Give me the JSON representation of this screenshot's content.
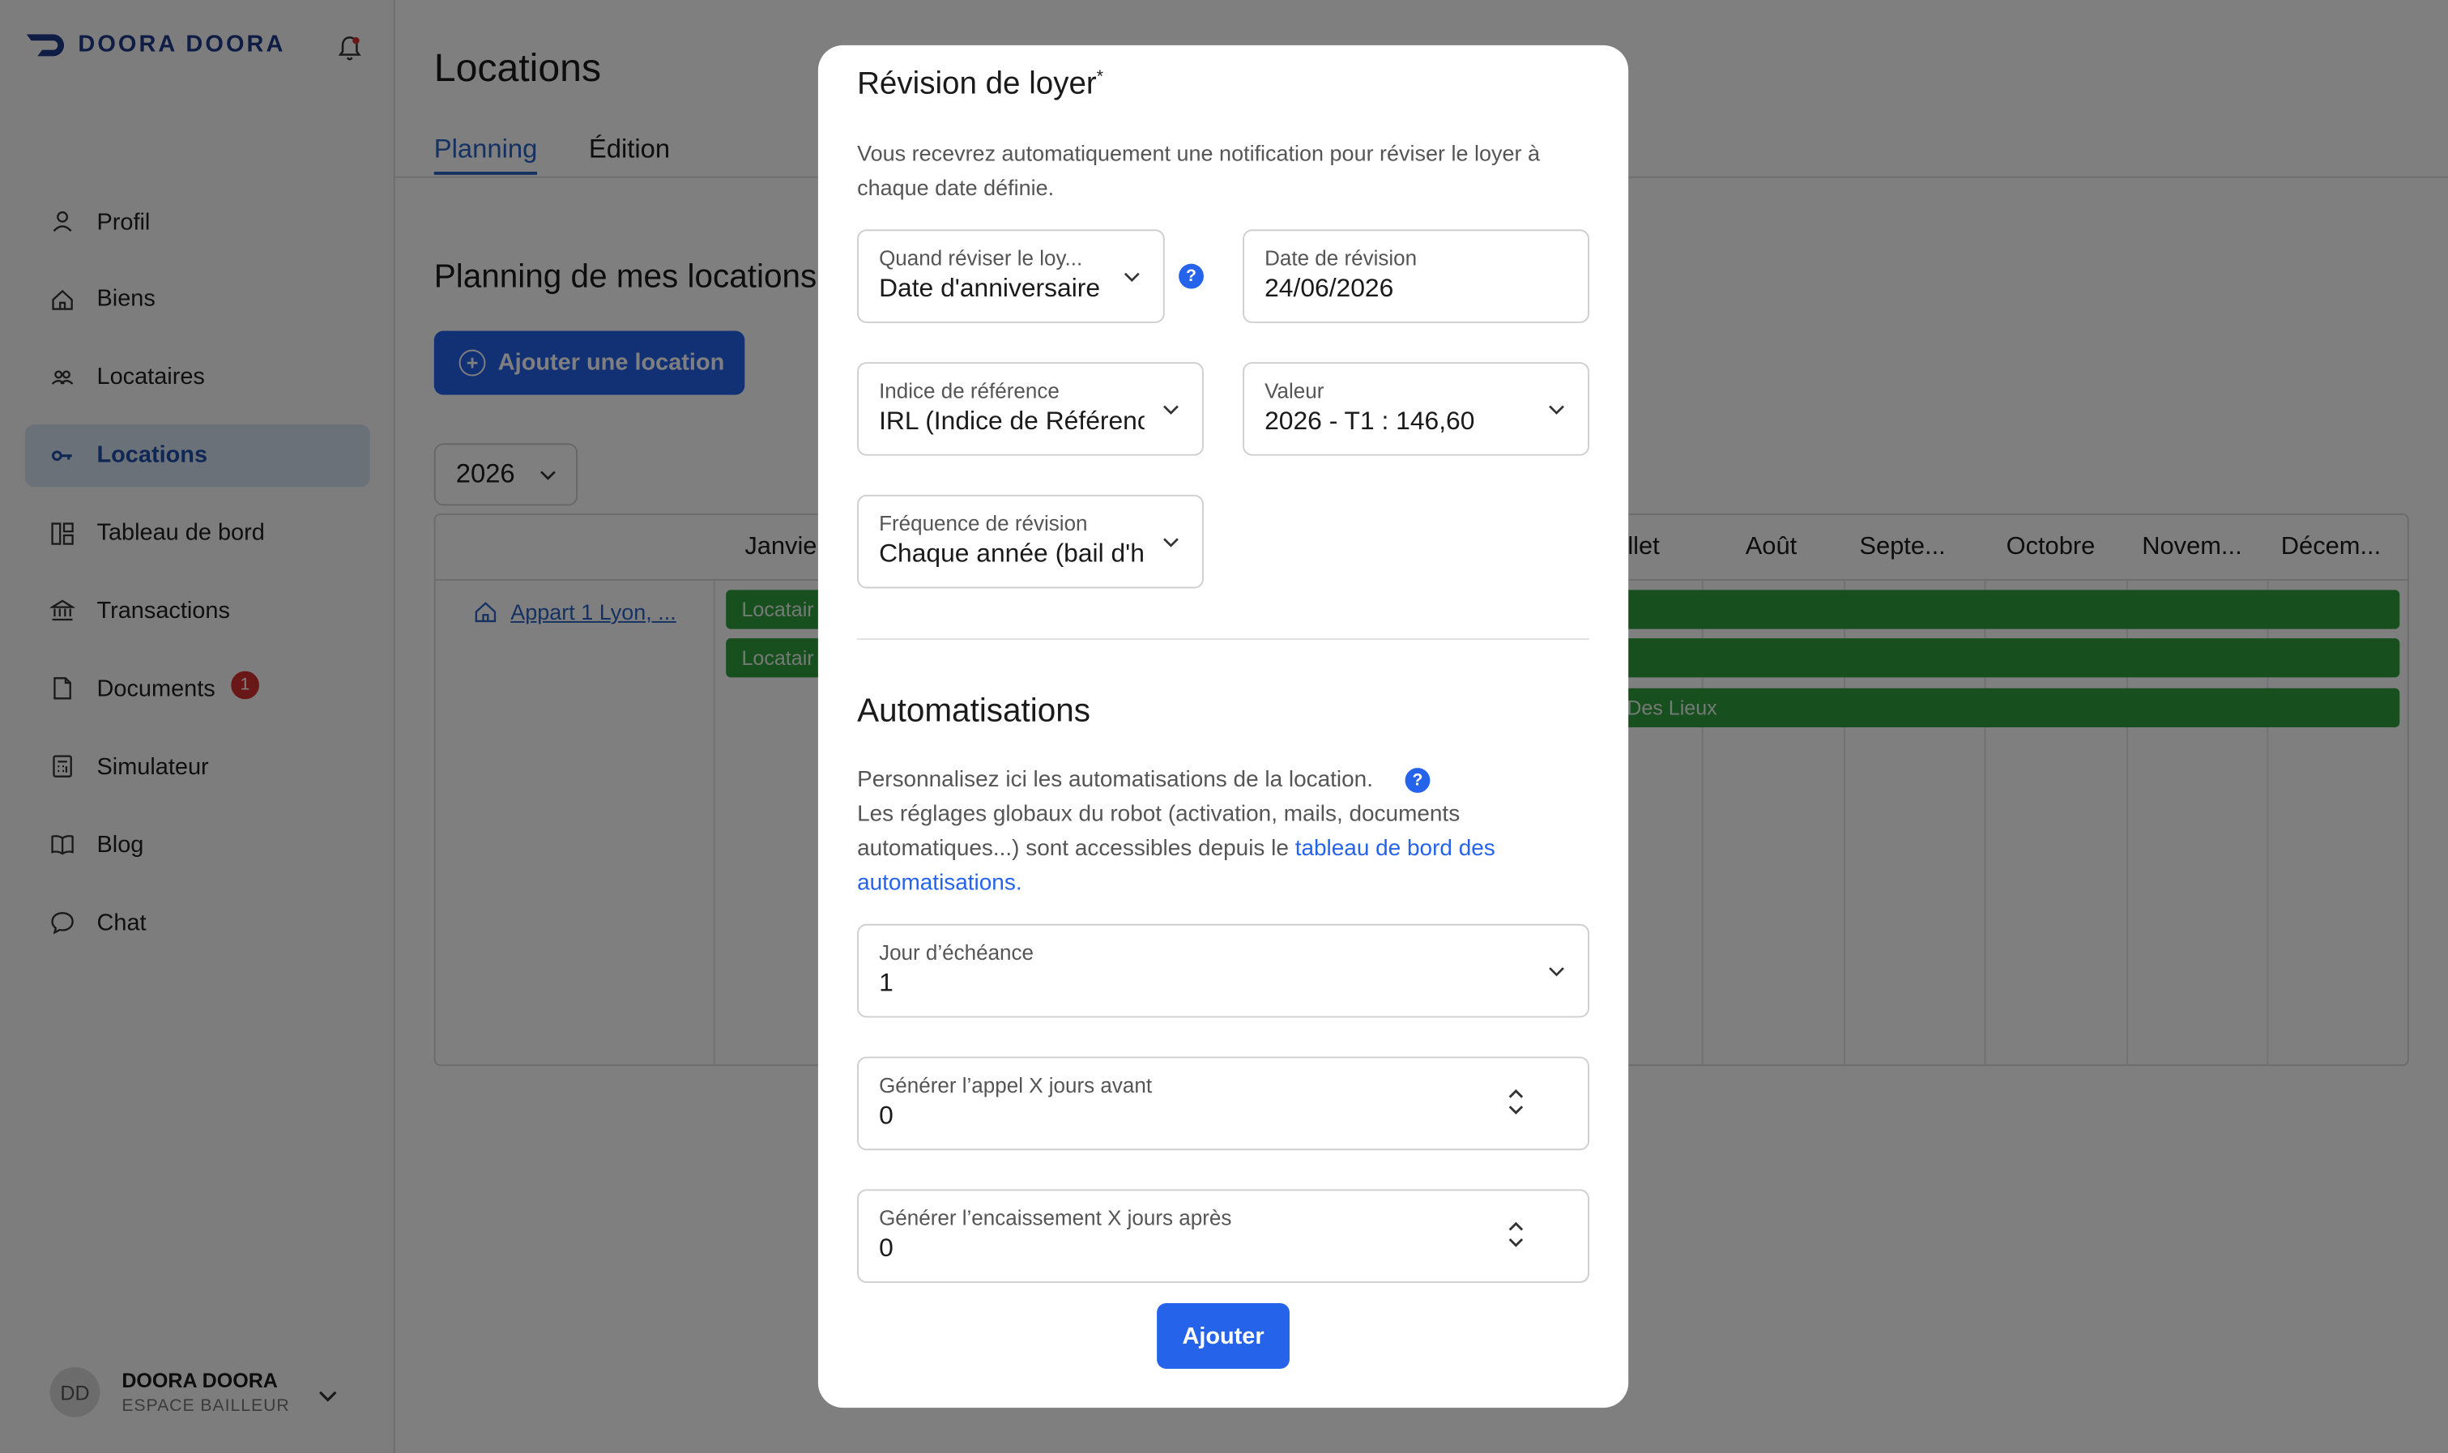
{
  "brand": {
    "name": "DOORA DOORA",
    "color": "#1f3a8a"
  },
  "sidebar": {
    "items": [
      {
        "label": "Profil",
        "icon": "user-icon"
      },
      {
        "label": "Biens",
        "icon": "home-icon"
      },
      {
        "label": "Locataires",
        "icon": "users-icon"
      },
      {
        "label": "Locations",
        "icon": "key-icon",
        "active": true
      },
      {
        "label": "Tableau de bord",
        "icon": "dashboard-icon"
      },
      {
        "label": "Transactions",
        "icon": "bank-icon"
      },
      {
        "label": "Documents",
        "icon": "document-icon",
        "badge": "1"
      },
      {
        "label": "Simulateur",
        "icon": "calculator-icon"
      },
      {
        "label": "Blog",
        "icon": "book-icon"
      },
      {
        "label": "Chat",
        "icon": "chat-icon"
      }
    ]
  },
  "user": {
    "initials": "DD",
    "name": "DOORA DOORA",
    "role": "ESPACE BAILLEUR"
  },
  "main": {
    "title": "Locations",
    "tabs": [
      {
        "label": "Planning",
        "active": true
      },
      {
        "label": "Édition"
      }
    ],
    "section_title": "Planning de mes locations",
    "add_button": "Ajouter une location",
    "year": "2026",
    "months_visible": [
      "Janvie",
      "illet",
      "Août",
      "Septe...",
      "Octobre",
      "Novem...",
      "Décem..."
    ],
    "property": "Appart 1 Lyon, ...",
    "bars": [
      "Locatair",
      "Locatair",
      "Des Lieux"
    ],
    "accent": "#2563eb",
    "bar_color": "#2e9e3e"
  },
  "modal": {
    "title": "Révision de loyer",
    "title_mark": "*",
    "description": "Vous recevrez automatiquement une notification pour réviser le loyer à chaque date définie.",
    "fields": {
      "when": {
        "label": "Quand réviser le loy...",
        "value": "Date d'anniversaire"
      },
      "date": {
        "label": "Date de révision",
        "value": "24/06/2026"
      },
      "index": {
        "label": "Indice de référence",
        "value": "IRL (Indice de Référenc"
      },
      "value": {
        "label": "Valeur",
        "value": "2026 - T1 : 146,60"
      },
      "frequency": {
        "label": "Fréquence de révision",
        "value": "Chaque année (bail d'h"
      }
    },
    "automations_title": "Automatisations",
    "automations_line1": "Personnalisez ici les automatisations de la location.",
    "automations_text": "Les réglages globaux du robot (activation, mails, documents automatiques...) sont accessibles depuis le",
    "automations_link": "tableau de bord des automatisations.",
    "due_day": {
      "label": "Jour d’échéance",
      "value": "1"
    },
    "call_days": {
      "label": "Générer l’appel X jours avant",
      "value": "0"
    },
    "collect_days": {
      "label": "Générer l’encaissement X jours après",
      "value": "0"
    },
    "help_glyph": "?",
    "submit": "Ajouter"
  }
}
